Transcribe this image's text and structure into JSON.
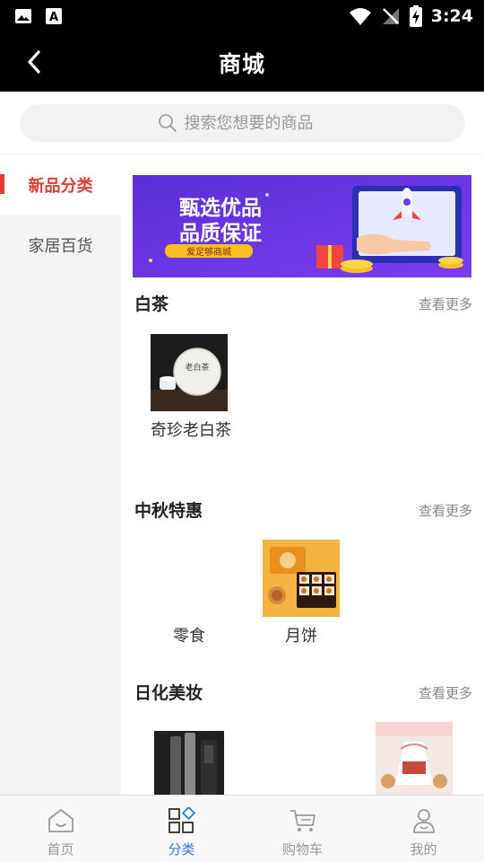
{
  "status_bar": {
    "time": "3:24"
  },
  "header": {
    "title": "商城"
  },
  "search": {
    "placeholder": "搜索您想要的商品"
  },
  "sidebar": {
    "items": [
      {
        "label": "新品分类",
        "active": true
      },
      {
        "label": "家居百货",
        "active": false
      }
    ]
  },
  "banner": {
    "headline_1": "甄选优品",
    "headline_2": "品质保证",
    "tag": "爱足够商城"
  },
  "sections": [
    {
      "title": "白茶",
      "more": "查看更多",
      "products": [
        {
          "name": "奇珍老白茶"
        }
      ]
    },
    {
      "title": "中秋特惠",
      "more": "查看更多",
      "products": [
        {
          "name": "零食"
        },
        {
          "name": "月饼"
        }
      ]
    },
    {
      "title": "日化美妆",
      "more": "查看更多",
      "products": []
    }
  ],
  "tab_bar": {
    "tabs": [
      {
        "label": "首页",
        "icon": "home-icon"
      },
      {
        "label": "分类",
        "icon": "category-icon",
        "active": true
      },
      {
        "label": "购物车",
        "icon": "cart-icon"
      },
      {
        "label": "我的",
        "icon": "profile-icon"
      }
    ]
  },
  "colors": {
    "accent": "#e23b32",
    "tab_active": "#2f7bd8",
    "header_bg": "#000000"
  }
}
